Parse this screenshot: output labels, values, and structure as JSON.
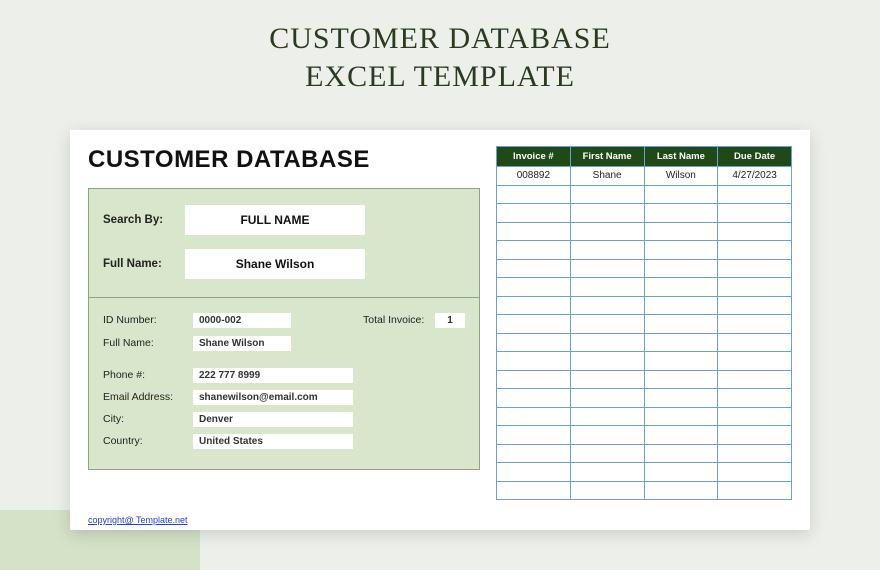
{
  "hero": {
    "line1": "CUSTOMER DATABASE",
    "line2": "EXCEL TEMPLATE"
  },
  "sheet": {
    "title": "CUSTOMER DATABASE",
    "search": {
      "search_by_label": "Search By:",
      "search_by_value": "FULL NAME",
      "full_name_label": "Full Name:",
      "full_name_value": "Shane Wilson"
    },
    "details": {
      "id_number_label": "ID Number:",
      "id_number_value": "0000-002",
      "full_name_label": "Full Name:",
      "full_name_value": "Shane Wilson",
      "total_invoice_label": "Total Invoice:",
      "total_invoice_value": "1",
      "phone_label": "Phone #:",
      "phone_value": "222 777 8999",
      "email_label": "Email Address:",
      "email_value": "shanewilson@email.com",
      "city_label": "City:",
      "city_value": "Denver",
      "country_label": "Country:",
      "country_value": "United States"
    },
    "table": {
      "headers": [
        "Invoice #",
        "First Name",
        "Last Name",
        "Due Date"
      ],
      "rows": [
        [
          "008892",
          "Shane",
          "Wilson",
          "4/27/2023"
        ]
      ],
      "empty_rows": 17
    },
    "copyright": "copyright@ Template.net"
  }
}
